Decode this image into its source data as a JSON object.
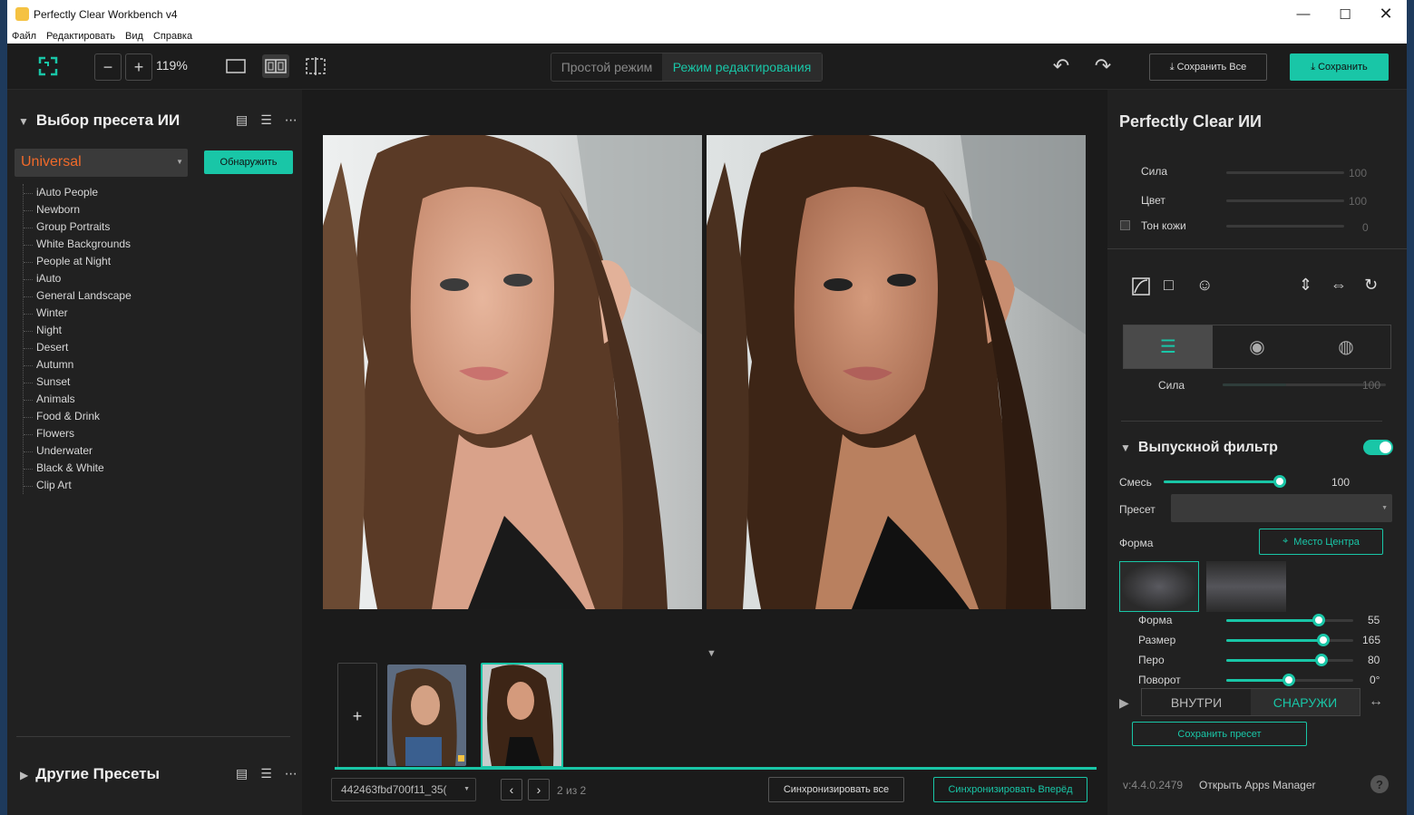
{
  "window": {
    "title": "Perfectly Clear Workbench v4"
  },
  "menu": [
    "Файл",
    "Редактировать",
    "Вид",
    "Справка"
  ],
  "toolbar": {
    "zoom": "119%",
    "mode_simple": "Простой режим",
    "mode_edit": "Режим редактирования",
    "save_all": "Сохранить Все",
    "save": "Сохранить"
  },
  "left": {
    "title": "Выбор пресета ИИ",
    "preset_value": "Universal",
    "detect_label": "Обнаружить",
    "presets": [
      "iAuto People",
      "Newborn",
      "Group Portraits",
      "White Backgrounds",
      "People at Night",
      "iAuto",
      "General Landscape",
      "Winter",
      "Night",
      "Desert",
      "Autumn",
      "Sunset",
      "Animals",
      "Food & Drink",
      "Flowers",
      "Underwater",
      "Black & White",
      "Clip Art"
    ],
    "other_title": "Другие Пресеты"
  },
  "center": {
    "file_name": "442463fbd700f11_35(",
    "counter": "2 из 2",
    "sync_all": "Синхронизировать все",
    "sync_forward": "Синхронизировать Вперёд"
  },
  "right": {
    "title": "Perfectly Clear ИИ",
    "sila_label": "Сила",
    "sila_value": "100",
    "color_label": "Цвет",
    "color_value": "100",
    "skin_label": "Тон кожи",
    "skin_value": "0",
    "tab_sila_label": "Сила",
    "tab_sila_value": "100",
    "filter_title": "Выпускной фильтр",
    "mix_label": "Смесь",
    "mix_value": "100",
    "preset_label": "Пресет",
    "shape_label": "Форма",
    "center_btn": "Место Центра",
    "sliders": [
      {
        "label": "Форма",
        "value": "55",
        "pos": 0.73
      },
      {
        "label": "Размер",
        "value": "165",
        "pos": 0.77
      },
      {
        "label": "Перо",
        "value": "80",
        "pos": 0.75
      },
      {
        "label": "Поворот",
        "value": "0°",
        "pos": 0.5
      }
    ],
    "inside": "ВНУТРИ",
    "outside": "СНАРУЖИ",
    "save_preset": "Сохранить пресет",
    "version": "v:4.4.0.2479",
    "apps_manager": "Открыть Apps Manager"
  },
  "colors": {
    "accent": "#19c6a7",
    "preset_orange": "#f06a2a"
  }
}
